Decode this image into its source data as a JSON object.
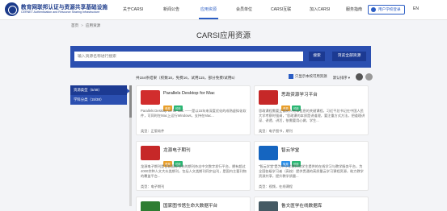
{
  "header": {
    "logo_cn": "教育网联邦认证与资源共享基础设施",
    "logo_en": "CERNET Authentication and Resource Sharing Infrastructure",
    "nav": [
      "关于CARSI",
      "新闻公告",
      "应用资源",
      "会员单位",
      "CARSI互联",
      "加入CARSI",
      "服务指南"
    ],
    "active_index": 2,
    "login_label": "用户学校登录",
    "lang": "EN"
  },
  "breadcrumb": [
    "首页",
    "应用资源"
  ],
  "page_title": "CARSI应用资源",
  "search": {
    "placeholder": "输入资源名称进行搜索",
    "search_label": "搜索",
    "all_label": "浏览全部资源"
  },
  "stats_text": "共154条结果（校数18，免费16，试用115，部分免费/试用5）",
  "filter_label": "只显示本校可用资源",
  "sort_label": "默认排序",
  "left_filters": [
    "资源类型（5/48）",
    "学科分类（15/38）"
  ],
  "cards": [
    {
      "name": "Parallels Desktop for Mac",
      "badges": [
        "收费",
        "可用"
      ],
      "desc": "Parallels Desktop 16 for Mac ——是以15年来深度优化的成熟虚拟化软件，可同时在Mac上运行Windows，支持在Mac...",
      "type": "类型：正版软件",
      "logo_color": "#d12d2d"
    },
    {
      "name": "思政资源学习平台",
      "badges": [
        "收费",
        "可用"
      ],
      "desc": "思政课程需要立德树人有本信息的关键课程，习近平总书记在中国人民大学考察时强调，“思政课的本质是讲道理，要注重方式方法，把道理讲深、讲透、讲活，依需要用心做，学生...",
      "type": "类型：电子图书，期刊",
      "logo_color": "#c62828"
    },
    {
      "name": "龙源电子期刊",
      "badges": [
        "收费",
        "可用"
      ],
      "desc": "龙源电子期刊是目前国际领先的期刊杂志中文数字发行平台，拥有超过4000余种人文大众类期刊，包括人文类期刊同步出刊，是国内主要刊物的覆盖平台...",
      "type": "类型：电子期刊",
      "logo_color": "#c62828"
    },
    {
      "name": "智云学堂",
      "badges": [
        "免费",
        "可用"
      ],
      "desc": "“智云学堂”是为中小学教师和学生提供的在线学习与教学服务平台，为全国各级学习者（高校）提供贯通的高质量云学习课程资源，助力教学资源共享，提升教学质量...",
      "type": "类型：视频，在线课程",
      "logo_color": "#1565c0"
    },
    {
      "name": "国家图书馆生命大数据平台",
      "badges": [],
      "desc": "",
      "type": "",
      "logo_color": "#2e7d32"
    },
    {
      "name": "鲁文医学在线数据库",
      "badges": [],
      "desc": "",
      "type": "",
      "logo_color": "#455a64"
    }
  ]
}
